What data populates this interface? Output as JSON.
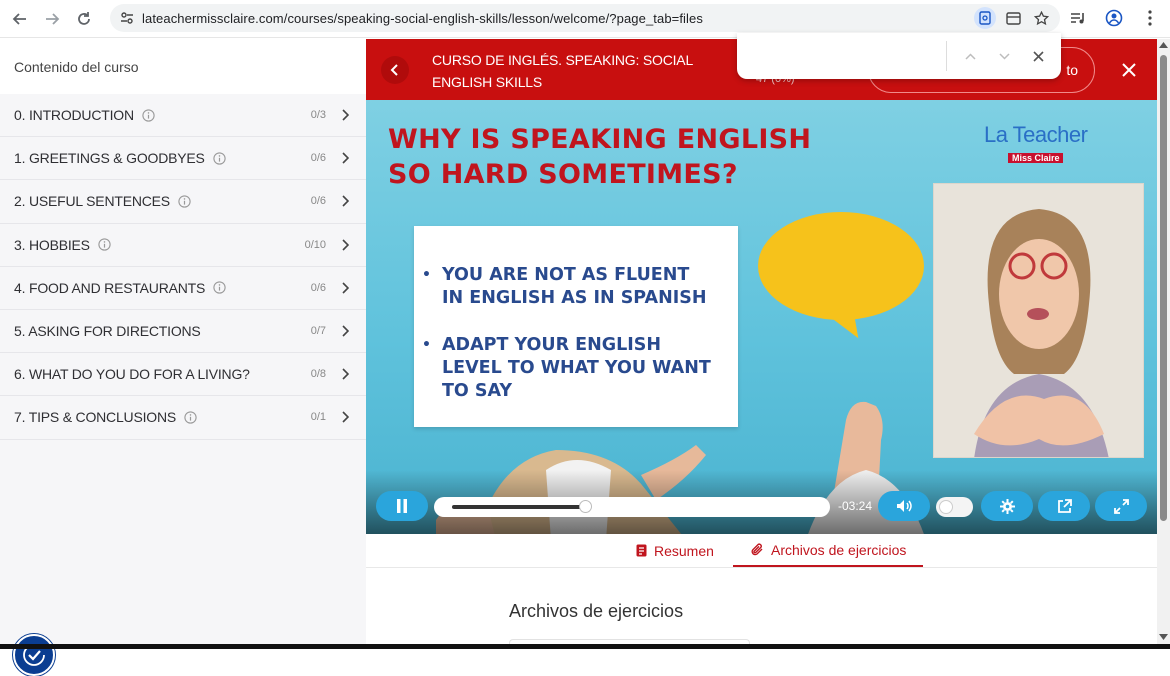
{
  "browser": {
    "url": "lateachermissclaire.com/courses/speaking-social-english-skills/lesson/welcome/?page_tab=files"
  },
  "sidebar": {
    "header": "Contenido del curso",
    "modules": [
      {
        "title": "0. INTRODUCTION",
        "count": "0/3",
        "info": true
      },
      {
        "title": "1. GREETINGS & GOODBYES",
        "count": "0/6",
        "info": true
      },
      {
        "title": "2. USEFUL SENTENCES",
        "count": "0/6",
        "info": true
      },
      {
        "title": "3. HOBBIES",
        "count": "0/10",
        "info": true
      },
      {
        "title": "4. FOOD AND RESTAURANTS",
        "count": "0/6",
        "info": true
      },
      {
        "title": "5. ASKING FOR DIRECTIONS",
        "count": "0/7",
        "info": false
      },
      {
        "title": "6. WHAT DO YOU DO FOR A LIVING?",
        "count": "0/8",
        "info": false
      },
      {
        "title": "7. TIPS & CONCLUSIONS",
        "count": "0/1",
        "info": true
      }
    ]
  },
  "course_bar": {
    "title": "CURSO DE INGLÉS. SPEAKING: SOCIAL ENGLISH SKILLS",
    "progress": "47 (0%)",
    "complete_label": "to",
    "accent": "#c80f0f"
  },
  "find_bar": {
    "value": ""
  },
  "video": {
    "slide_title": "WHY IS SPEAKING ENGLISH SO HARD SOMETIMES?",
    "brand_name": "La Teacher",
    "brand_sub": "Miss Claire",
    "bullets": [
      "YOU ARE NOT AS FLUENT IN ENGLISH AS IN SPANISH",
      "ADAPT YOUR ENGLISH LEVEL TO WHAT YOU WANT TO SAY"
    ],
    "time_remaining": "-03:24",
    "progress_fraction": 0.37,
    "controls_color": "#2aa5dc"
  },
  "tabs": [
    {
      "label": "Resumen",
      "icon": "document-icon",
      "active": false
    },
    {
      "label": "Archivos de ejercicios",
      "icon": "paperclip-icon",
      "active": true
    }
  ],
  "section_title": "Archivos de ejercicios"
}
